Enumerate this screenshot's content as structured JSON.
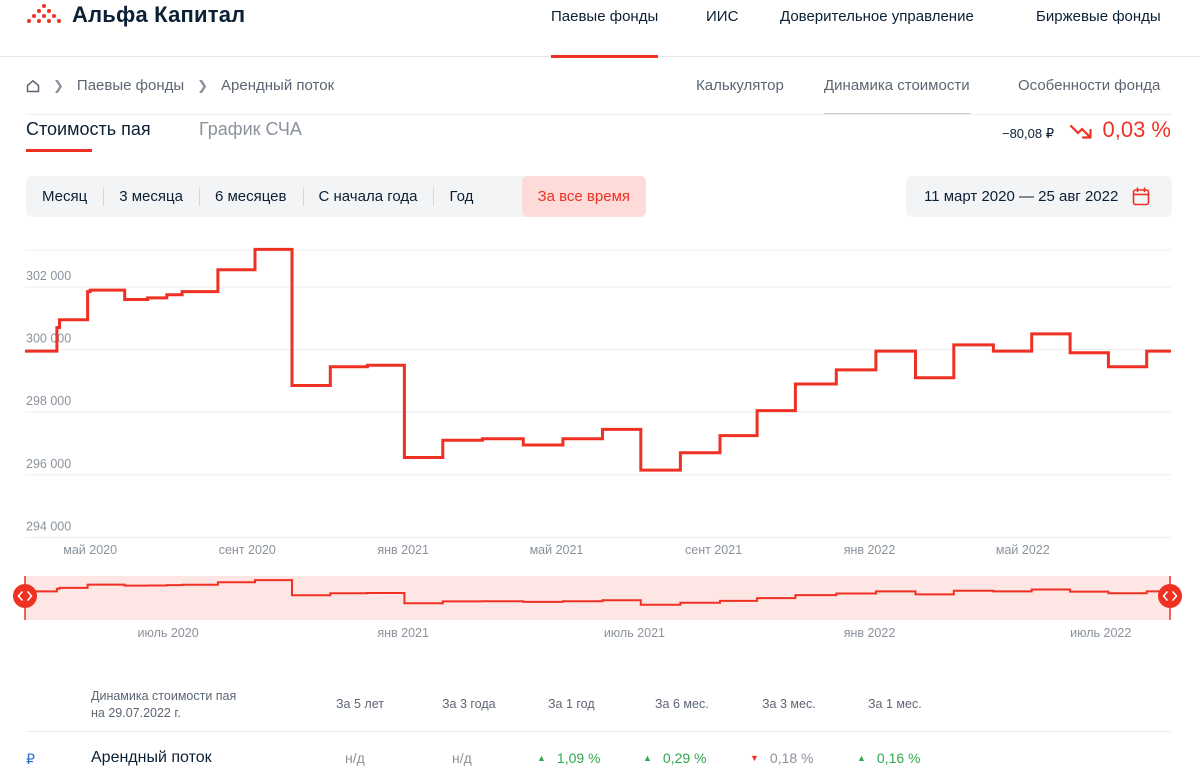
{
  "header": {
    "logo_text": "Альфа Капитал",
    "nav": [
      "Паевые фонды",
      "ИИС",
      "Доверительное управление",
      "Биржевые фонды"
    ],
    "active_nav": 0
  },
  "breadcrumb": {
    "items": [
      "Паевые фонды",
      "Арендный поток"
    ]
  },
  "subnav": {
    "items": [
      "Калькулятор",
      "Динамика стоимости",
      "Особенности фонда"
    ],
    "active": 1
  },
  "tabs": {
    "items": [
      "Стоимость пая",
      "График СЧА"
    ],
    "active": 0
  },
  "change": {
    "abs": "−80,08 ₽",
    "pct": "0,03 %",
    "direction": "down"
  },
  "periods": {
    "items": [
      "Месяц",
      "3 месяца",
      "6 месяцев",
      "С начала года",
      "Год",
      "За все время"
    ],
    "active": 5
  },
  "date_range": "11 март 2020 — 25 авг 2022",
  "colors": {
    "accent": "#ef3124",
    "up": "#2fa84f",
    "text": "#0b1f35",
    "muted": "#8a929c"
  },
  "chart_data": {
    "type": "line",
    "x_start": "2020-03-11",
    "x_end": "2022-08-25",
    "ylim": [
      293500,
      303500
    ],
    "y_ticks": [
      294000,
      296000,
      298000,
      300000,
      302000
    ],
    "y_tick_labels": [
      "294 000",
      "296 000",
      "298 000",
      "300 000",
      "302 000"
    ],
    "x_tick_labels": [
      "май 2020",
      "сент 2020",
      "янв 2021",
      "май 2021",
      "сент 2021",
      "янв 2022",
      "май 2022"
    ],
    "x_tick_dates": [
      "2020-05-01",
      "2020-09-01",
      "2021-01-01",
      "2021-05-01",
      "2021-09-01",
      "2022-01-01",
      "2022-05-01"
    ],
    "series": [
      {
        "step": "post",
        "points": [
          [
            "2020-03-11",
            299950
          ],
          [
            "2020-04-05",
            300700
          ],
          [
            "2020-04-07",
            300950
          ],
          [
            "2020-04-18",
            300950
          ],
          [
            "2020-04-29",
            301850
          ],
          [
            "2020-05-01",
            301900
          ],
          [
            "2020-05-28",
            301600
          ],
          [
            "2020-06-15",
            301650
          ],
          [
            "2020-06-30",
            301750
          ],
          [
            "2020-07-12",
            301850
          ],
          [
            "2020-08-09",
            302550
          ],
          [
            "2020-09-07",
            303200
          ],
          [
            "2020-10-06",
            298850
          ],
          [
            "2020-11-05",
            299450
          ],
          [
            "2020-12-04",
            299500
          ],
          [
            "2021-01-02",
            296550
          ],
          [
            "2021-02-01",
            297100
          ],
          [
            "2021-03-04",
            297150
          ],
          [
            "2021-04-05",
            296950
          ],
          [
            "2021-05-06",
            297150
          ],
          [
            "2021-06-06",
            297450
          ],
          [
            "2021-07-06",
            296150
          ],
          [
            "2021-08-06",
            296700
          ],
          [
            "2021-09-06",
            297250
          ],
          [
            "2021-10-05",
            298050
          ],
          [
            "2021-11-04",
            298900
          ],
          [
            "2021-12-06",
            299350
          ],
          [
            "2022-01-06",
            299950
          ],
          [
            "2022-02-06",
            299100
          ],
          [
            "2022-03-08",
            300150
          ],
          [
            "2022-04-08",
            299950
          ],
          [
            "2022-05-08",
            300500
          ],
          [
            "2022-06-07",
            299900
          ],
          [
            "2022-07-07",
            299450
          ],
          [
            "2022-08-06",
            299950
          ],
          [
            "2022-08-25",
            299950
          ]
        ]
      }
    ],
    "navigator": {
      "x_tick_labels": [
        "июль 2020",
        "янв 2021",
        "июль 2021",
        "янв 2022",
        "июль 2022"
      ],
      "x_tick_dates": [
        "2020-07-01",
        "2021-01-01",
        "2021-07-01",
        "2022-01-01",
        "2022-07-01"
      ]
    }
  },
  "table": {
    "header_title": "Динамика стоимости пая",
    "header_date": "на 29.07.2022 г.",
    "columns": [
      "За 5 лет",
      "За 3 года",
      "За 1 год",
      "За 6 мес.",
      "За 3 мес.",
      "За 1 мес."
    ],
    "rows": [
      {
        "currency": "₽",
        "name": "Арендный поток",
        "values": [
          "н/д",
          "н/д",
          "1,09 %",
          "0,29 %",
          "0,18 %",
          "0,16 %"
        ],
        "directions": [
          "none",
          "none",
          "up",
          "up",
          "down",
          "up"
        ]
      }
    ]
  }
}
